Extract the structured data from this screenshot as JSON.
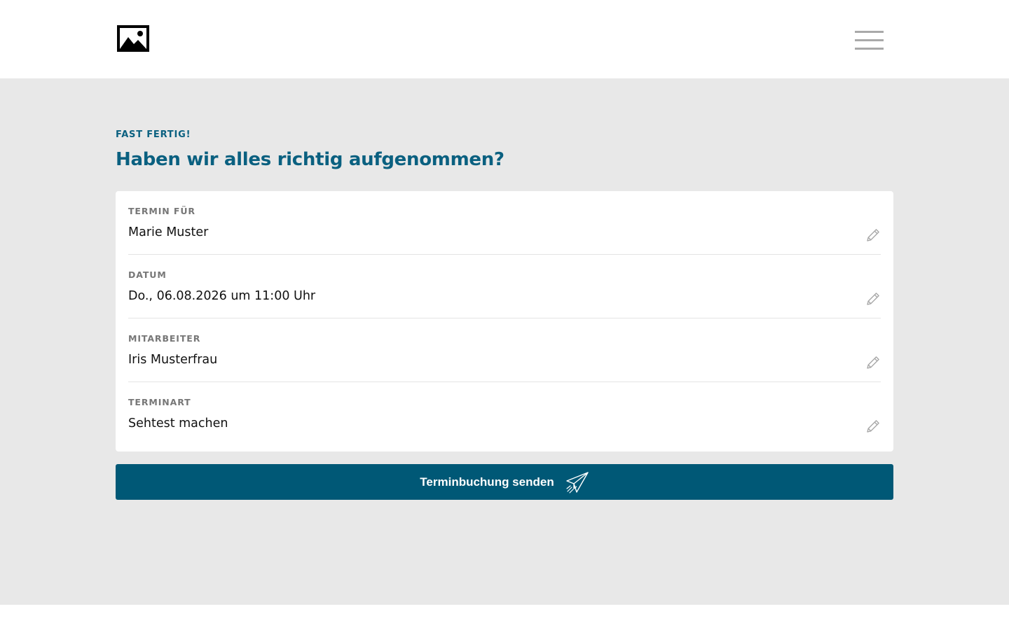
{
  "header": {
    "logo_icon": "image-icon",
    "menu_icon": "hamburger-menu-icon"
  },
  "summary": {
    "eyebrow": "FAST FERTIG!",
    "title": "Haben wir alles richtig aufgenommen?",
    "rows": [
      {
        "label": "TERMIN FÜR",
        "value": "Marie Muster",
        "action_icon": "pencil-icon"
      },
      {
        "label": "DATUM",
        "value": "Do., 06.08.2026 um 11:00 Uhr",
        "action_icon": "pencil-icon"
      },
      {
        "label": "MITARBEITER",
        "value": "Iris Musterfrau",
        "action_icon": "pencil-icon"
      },
      {
        "label": "TERMINART",
        "value": "Sehtest machen",
        "action_icon": "pencil-icon"
      }
    ]
  },
  "submit": {
    "label": "Terminbuchung senden",
    "icon": "paper-plane-icon"
  },
  "colors": {
    "accent": "#0a6080",
    "button": "#005876",
    "background": "#e8e8e8",
    "label": "#777777"
  }
}
